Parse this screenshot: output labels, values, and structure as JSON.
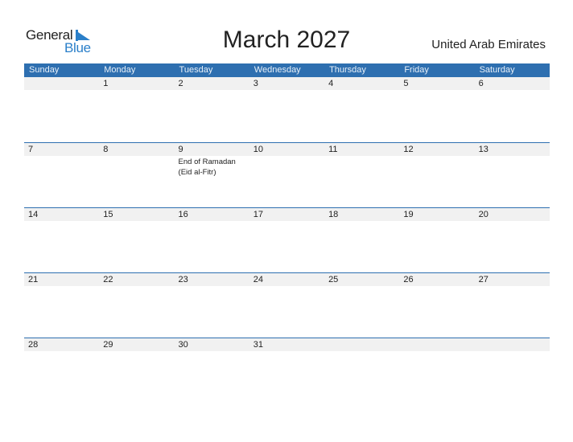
{
  "logo": {
    "word1": "General",
    "word2": "Blue",
    "icon": "triangle-flag-icon",
    "accent": "#2a7fc9"
  },
  "title": "March 2027",
  "country": "United Arab Emirates",
  "colors": {
    "header_bg": "#2e6fb0",
    "day_row_bg": "#f1f1f1"
  },
  "weekdays": [
    "Sunday",
    "Monday",
    "Tuesday",
    "Wednesday",
    "Thursday",
    "Friday",
    "Saturday"
  ],
  "weeks": [
    {
      "days": [
        "",
        "1",
        "2",
        "3",
        "4",
        "5",
        "6"
      ],
      "events": [
        "",
        "",
        "",
        "",
        "",
        "",
        ""
      ]
    },
    {
      "days": [
        "7",
        "8",
        "9",
        "10",
        "11",
        "12",
        "13"
      ],
      "events": [
        "",
        "",
        "End of Ramadan (Eid al-Fitr)",
        "",
        "",
        "",
        ""
      ]
    },
    {
      "days": [
        "14",
        "15",
        "16",
        "17",
        "18",
        "19",
        "20"
      ],
      "events": [
        "",
        "",
        "",
        "",
        "",
        "",
        ""
      ]
    },
    {
      "days": [
        "21",
        "22",
        "23",
        "24",
        "25",
        "26",
        "27"
      ],
      "events": [
        "",
        "",
        "",
        "",
        "",
        "",
        ""
      ]
    },
    {
      "days": [
        "28",
        "29",
        "30",
        "31",
        "",
        "",
        ""
      ],
      "events": [
        "",
        "",
        "",
        "",
        "",
        "",
        ""
      ]
    }
  ]
}
